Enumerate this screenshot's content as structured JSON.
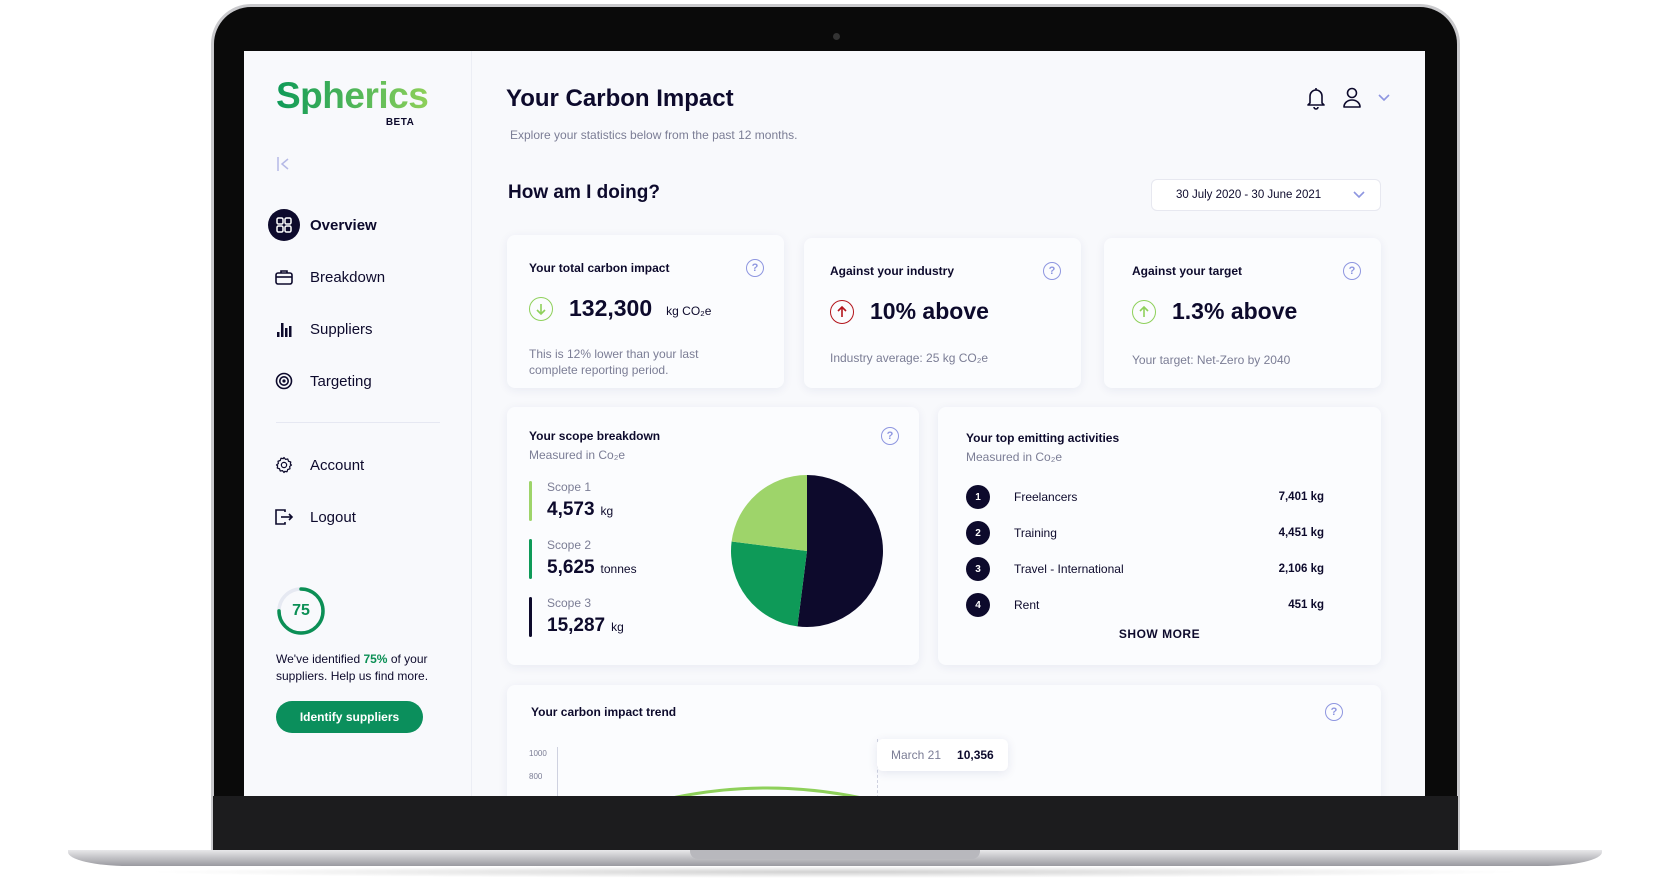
{
  "brand": {
    "name": "Spherics",
    "badge": "BETA"
  },
  "colors": {
    "navy": "#0d0a2c",
    "green_dark": "#0b8f5c",
    "green_mid": "#0e9a58",
    "green_light": "#9ed46a",
    "alert_red": "#b3141b",
    "help_blue": "#8e96e0"
  },
  "sidebar": {
    "items": [
      {
        "label": "Overview",
        "icon": "grid-icon",
        "active": true
      },
      {
        "label": "Breakdown",
        "icon": "briefcase-icon"
      },
      {
        "label": "Suppliers",
        "icon": "bar-chart-icon"
      },
      {
        "label": "Targeting",
        "icon": "target-icon"
      }
    ],
    "secondary_items": [
      {
        "label": "Account",
        "icon": "gear-icon"
      },
      {
        "label": "Logout",
        "icon": "logout-icon"
      }
    ],
    "supplier_progress": {
      "percent": 75,
      "label": "75",
      "text_before": "We've identified ",
      "highlight": "75%",
      "text_after": " of your suppliers. Help us find more."
    },
    "identify_button": "Identify suppliers"
  },
  "header": {
    "title": "Your Carbon Impact",
    "subtitle": "Explore your statistics below from the past 12 months."
  },
  "overview": {
    "section_title": "How am I doing?",
    "date_range": "30 July 2020 - 30 June 2021"
  },
  "stats": [
    {
      "title": "Your total carbon impact",
      "value": "132,300",
      "unit": "kg CO₂e",
      "direction": "down",
      "tone": "good",
      "note": "This is 12% lower than your last complete reporting period."
    },
    {
      "title": "Against your industry",
      "value": "10% above",
      "direction": "up",
      "tone": "bad",
      "note": "Industry average: 25 kg CO₂e"
    },
    {
      "title": "Against your target",
      "value": "1.3% above",
      "direction": "up",
      "tone": "good",
      "note": "Your target: Net-Zero by 2040"
    }
  ],
  "scope_breakdown": {
    "title": "Your scope breakdown",
    "subtitle": "Measured in Co₂e",
    "items": [
      {
        "label": "Scope 1",
        "value": "4,573",
        "unit": "kg",
        "color": "#9ed46a"
      },
      {
        "label": "Scope 2",
        "value": "5,625",
        "unit": "tonnes",
        "color": "#0e9a58"
      },
      {
        "label": "Scope 3",
        "value": "15,287",
        "unit": "kg",
        "color": "#0d0a2c"
      }
    ]
  },
  "chart_data": {
    "type": "pie",
    "title": "Your scope breakdown",
    "labels": [
      "Scope 3",
      "Scope 2",
      "Scope 1"
    ],
    "values": [
      52,
      25,
      23
    ],
    "values_note": "visual slice shares (percent) as drawn",
    "colors": [
      "#0d0a2c",
      "#0e9a58",
      "#9ed46a"
    ]
  },
  "top_activities": {
    "title": "Your top emitting activities",
    "subtitle": "Measured in Co₂e",
    "items": [
      {
        "rank": "1",
        "name": "Freelancers",
        "value": "7,401 kg"
      },
      {
        "rank": "2",
        "name": "Training",
        "value": "4,451 kg"
      },
      {
        "rank": "3",
        "name": "Travel - International",
        "value": "2,106 kg"
      },
      {
        "rank": "4",
        "name": "Rent",
        "value": "451 kg"
      }
    ],
    "show_more": "SHOW MORE"
  },
  "trend": {
    "title": "Your carbon impact trend",
    "y_ticks": [
      "1000",
      "800"
    ],
    "tooltip": {
      "label": "March 21",
      "value": "10,356"
    }
  }
}
